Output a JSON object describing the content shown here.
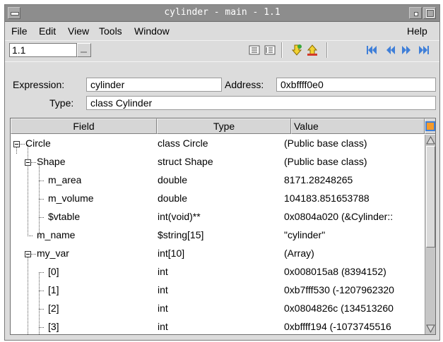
{
  "window": {
    "title": "cylinder - main - 1.1"
  },
  "menubar": {
    "items": [
      {
        "label": "File"
      },
      {
        "label": "Edit"
      },
      {
        "label": "View"
      },
      {
        "label": "Tools"
      },
      {
        "label": "Window"
      },
      {
        "label": "Help"
      }
    ]
  },
  "toolbar": {
    "frame_value": "1.1",
    "icons": [
      "collapse-all-icon",
      "expand-all-icon",
      "dive-icon",
      "undive-icon",
      "first-icon",
      "previous-icon",
      "next-icon",
      "last-icon"
    ]
  },
  "expression": {
    "expression_label": "Expression:",
    "expression_value": "cylinder",
    "address_label": "Address:",
    "address_value": "0xbffff0e0",
    "type_label": "Type:",
    "type_value": "class Cylinder"
  },
  "table": {
    "columns": [
      "Field",
      "Type",
      "Value"
    ],
    "rows": [
      {
        "field": "Circle",
        "type": "class Circle",
        "value": "(Public base class)"
      },
      {
        "field": "Shape",
        "type": "struct Shape",
        "value": "(Public base class)"
      },
      {
        "field": "m_area",
        "type": "double",
        "value": "8171.28248265"
      },
      {
        "field": "m_volume",
        "type": "double",
        "value": "104183.851653788"
      },
      {
        "field": "$vtable",
        "type": "int(void)**",
        "value": "0x0804a020 (&Cylinder::"
      },
      {
        "field": "m_name",
        "type": "$string[15]",
        "value": "\"cylinder\""
      },
      {
        "field": "my_var",
        "type": "int[10]",
        "value": "(Array)"
      },
      {
        "field": "[0]",
        "type": "int",
        "value": "0x008015a8 (8394152)"
      },
      {
        "field": "[1]",
        "type": "int",
        "value": "0xb7fff530 (-1207962320"
      },
      {
        "field": "[2]",
        "type": "int",
        "value": "0x0804826c (134513260"
      },
      {
        "field": "[3]",
        "type": "int",
        "value": "0xbffff194 (-1073745516"
      }
    ]
  },
  "colors": {
    "titlebar": "#8d8d8d",
    "window": "#dcdcdc",
    "arrow_yellow": "#f2d233",
    "nav_blue": "#3f7fd8"
  }
}
